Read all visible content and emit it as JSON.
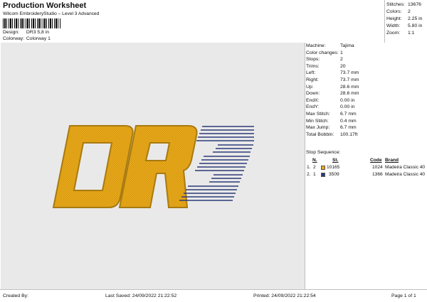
{
  "header": {
    "title": "Production Worksheet",
    "subtitle": "Wilcom EmbroideryStudio – Level 3 Advanced",
    "design_label": "Design:",
    "design_value": "DR3 5,8 in",
    "colorway_label": "Colorway:",
    "colorway_value": "Colorway 1"
  },
  "stats": [
    {
      "label": "Stitches:",
      "value": "13676"
    },
    {
      "label": "Colors:",
      "value": "2"
    },
    {
      "label": "Height:",
      "value": "2.25 in"
    },
    {
      "label": "Width:",
      "value": "5.80 in"
    },
    {
      "label": "Zoom:",
      "value": "1:1"
    }
  ],
  "info": [
    {
      "label": "Machine:",
      "value": "Tajima"
    },
    {
      "label": "Color changes:",
      "value": "1"
    },
    {
      "label": "Stops:",
      "value": "2"
    },
    {
      "label": "Trims:",
      "value": "20"
    },
    {
      "label": "Left:",
      "value": "73.7 mm"
    },
    {
      "label": "Right:",
      "value": "73.7 mm"
    },
    {
      "label": "Up:",
      "value": "28.6 mm"
    },
    {
      "label": "Down:",
      "value": "28.6 mm"
    },
    {
      "label": "EndX:",
      "value": "0.00 in"
    },
    {
      "label": "EndY:",
      "value": "0.00 in"
    },
    {
      "label": "Max Stitch:",
      "value": "6.7 mm"
    },
    {
      "label": "Min Stitch:",
      "value": "0.4 mm"
    },
    {
      "label": "Max Jump:",
      "value": "6.7 mm"
    },
    {
      "label": "Total Bobbin:",
      "value": "100.17ft"
    }
  ],
  "sequence": {
    "title": "Stop Sequence:",
    "columns": {
      "n": "N.",
      "st": "St.",
      "code": "Code",
      "brand": "Brand"
    },
    "rows": [
      {
        "idx": "1.",
        "n": "2",
        "color": "#e8a818",
        "st": "10165",
        "code": "1024",
        "brand": "Madeira Classic 40"
      },
      {
        "idx": "2.",
        "n": "1",
        "color": "#2c3a78",
        "st": "3509",
        "code": "1366",
        "brand": "Madeira Classic 40"
      }
    ]
  },
  "design": {
    "letters": "DR"
  },
  "colors": {
    "gold": "#e8a818",
    "gold_dark": "#a87a10",
    "navy": "#2c3a78",
    "canvas": "#e9e9e9"
  },
  "footer": {
    "created_by": "Created By:",
    "last_saved": "Last Saved: 24/09/2022 21:22:52",
    "printed": "Printed: 24/09/2022 21:22:54",
    "page": "Page 1 of 1"
  }
}
